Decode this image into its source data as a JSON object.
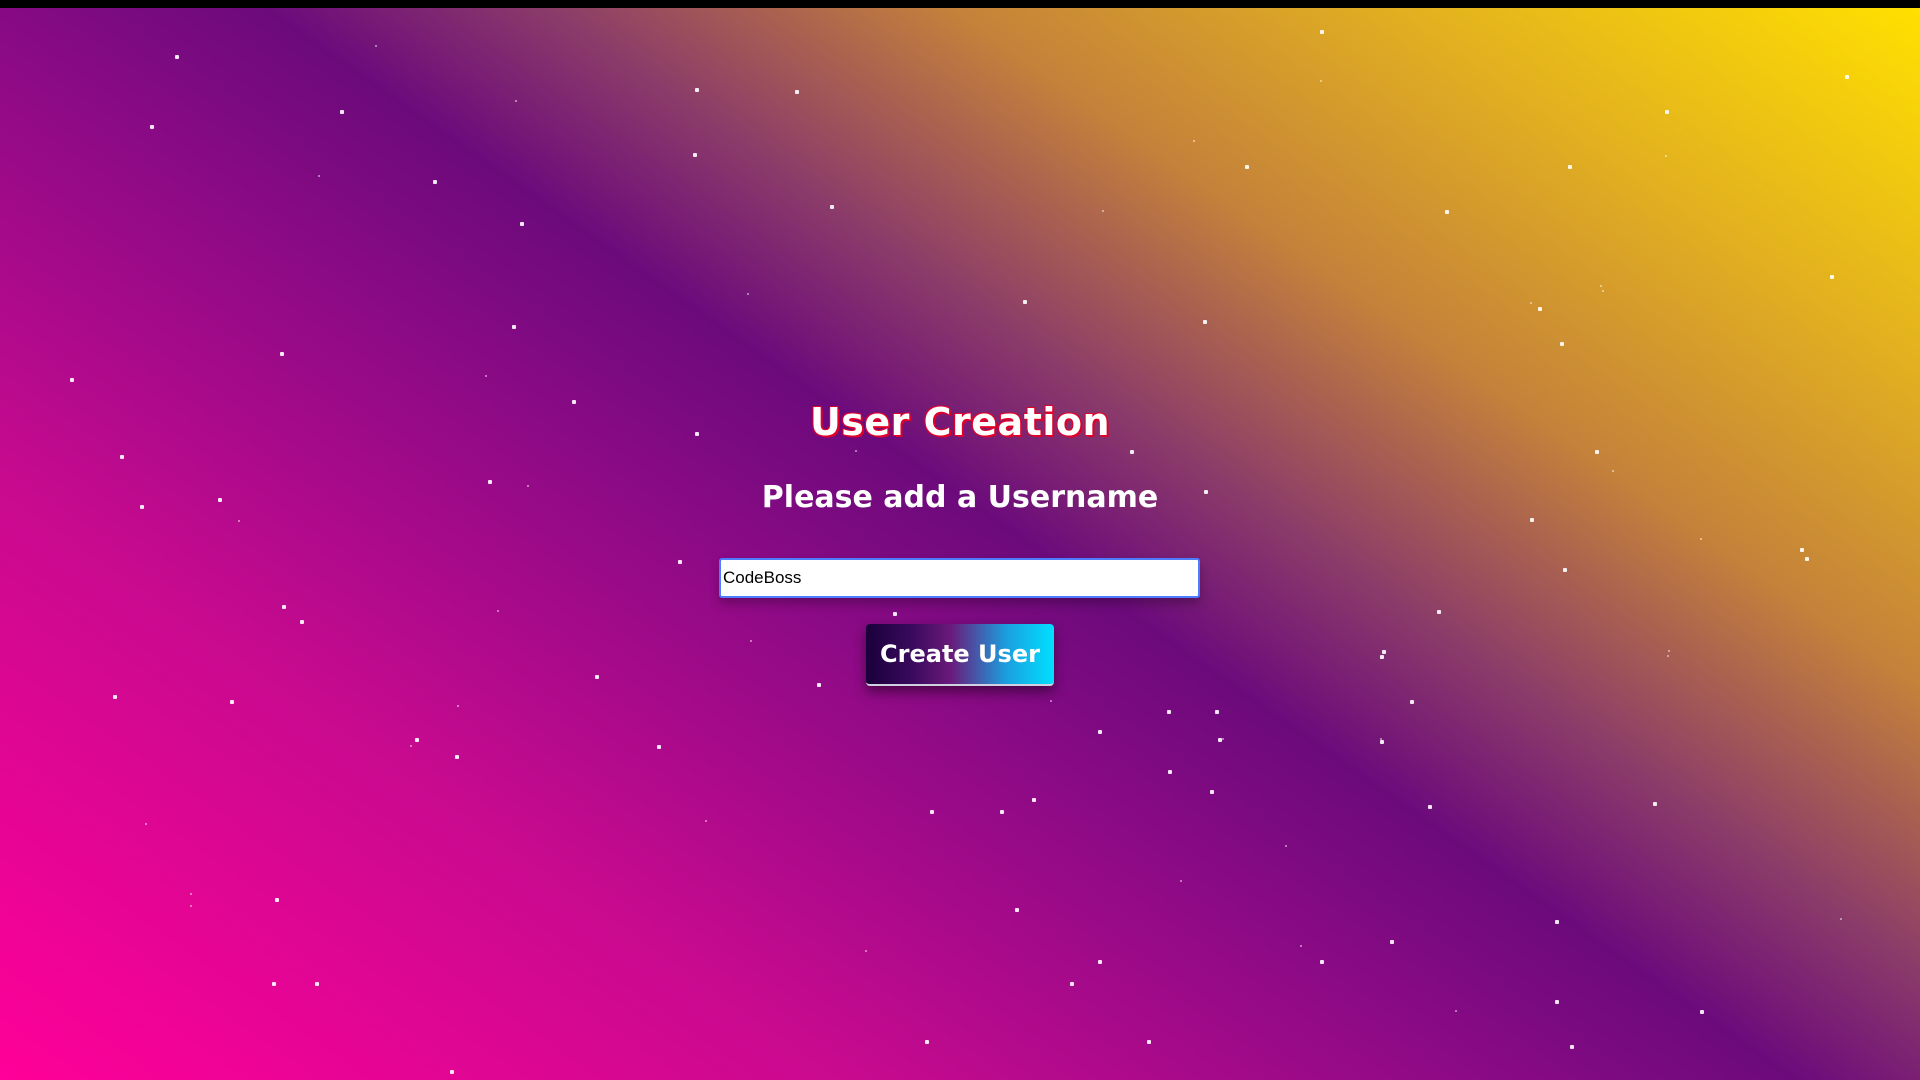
{
  "page": {
    "title": "User Creation",
    "subtitle": "Please add a Username"
  },
  "form": {
    "username_value": "CodeBoss",
    "submit_label": "Create User"
  },
  "colors": {
    "background_gradient": [
      "#ff0099",
      "#6c0a7c",
      "#ffe000"
    ],
    "title_outline": "#e0002a",
    "button_gradient": [
      "#1a003a",
      "#00e0ff"
    ],
    "input_border": "#4d7cff"
  }
}
